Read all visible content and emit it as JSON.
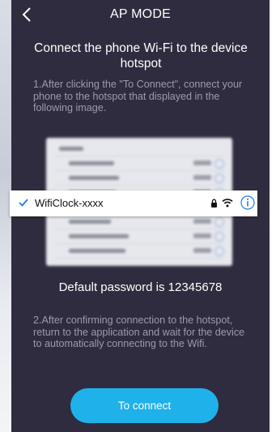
{
  "nav": {
    "title": "AP MODE",
    "back_icon": "chevron-left-icon"
  },
  "heading": "Connect the phone Wi-Fi to the device hotspot",
  "step1": "1.After clicking the \"To Connect\", connect your phone to the hotspot that displayed in the following image.",
  "wifi_row": {
    "ssid": "WifiClock-xxxx",
    "icons": [
      "checkmark-icon",
      "lock-icon",
      "wifi-icon",
      "info-icon"
    ]
  },
  "password_text": "Default password is 12345678",
  "step2": "2.After confirming connection to the hotspot, return to the application and wait for the device to automatically connecting to the Wifi.",
  "connect_button": "To connect",
  "colors": {
    "background": "#2e2c3e",
    "accent": "#1fb1ea",
    "muted_text": "#9c9ab0"
  }
}
